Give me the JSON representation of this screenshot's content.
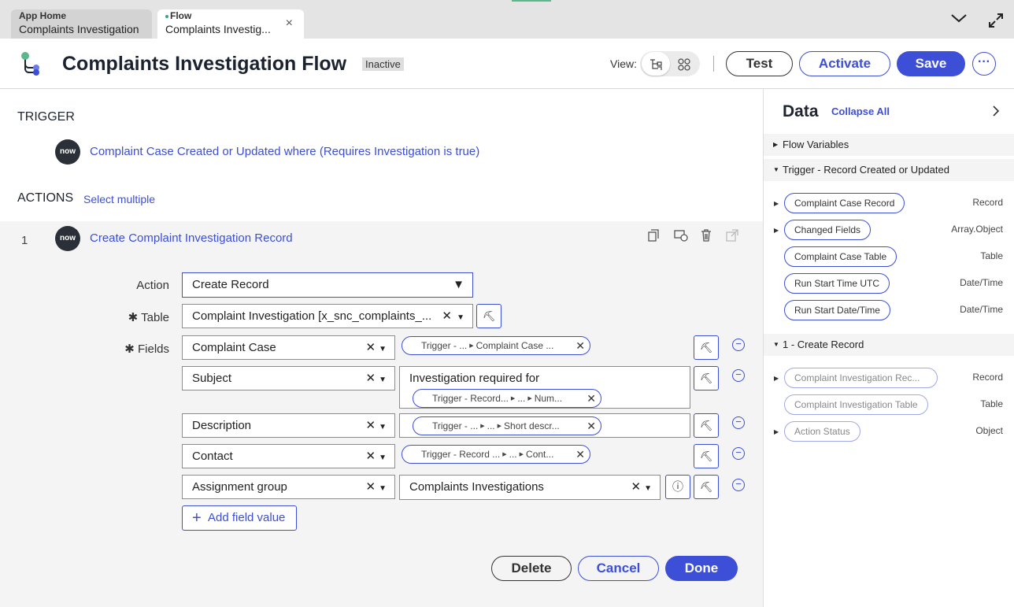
{
  "tabs": [
    {
      "title": "App Home",
      "subtitle": "Complaints Investigation"
    },
    {
      "title": "Flow",
      "subtitle": "Complaints Investig...",
      "close": "×"
    }
  ],
  "header": {
    "title": "Complaints Investigation Flow",
    "status": "Inactive",
    "view_label": "View:",
    "buttons": {
      "test": "Test",
      "activate": "Activate",
      "save": "Save",
      "more": "···"
    }
  },
  "trigger": {
    "section_label": "TRIGGER",
    "badge": "now",
    "description": "Complaint Case Created or Updated where (Requires Investigation is true)"
  },
  "actions": {
    "section_label": "ACTIONS",
    "select_multiple": "Select multiple",
    "step_number": "1",
    "badge": "now",
    "step_title": "Create Complaint Investigation Record"
  },
  "form": {
    "action_label": "Action",
    "action_value": "Create Record",
    "table_label": "Table",
    "table_value": "Complaint Investigation [x_snc_complaints_...",
    "fields_label": "Fields",
    "rows": [
      {
        "field": "Complaint Case",
        "pill_a": "Trigger - ...",
        "pill_b": "Complaint Case ..."
      },
      {
        "field": "Subject",
        "text": "Investigation required for",
        "pill_a": "Trigger - Record...",
        "pill_b": "...",
        "pill_c": "Num..."
      },
      {
        "field": "Description",
        "pill_a": "Trigger - ...",
        "pill_b": "...",
        "pill_c": "Short descr..."
      },
      {
        "field": "Contact",
        "pill_a": "Trigger - Record ...",
        "pill_b": "...",
        "pill_c": "Cont..."
      },
      {
        "field": "Assignment group",
        "value": "Complaints Investigations"
      }
    ],
    "add_field": "Add field value",
    "buttons": {
      "delete": "Delete",
      "cancel": "Cancel",
      "done": "Done"
    }
  },
  "data_panel": {
    "title": "Data",
    "collapse_all": "Collapse All",
    "groups": [
      {
        "label": "Flow Variables"
      },
      {
        "label": "Trigger - Record Created or Updated",
        "items": [
          {
            "label": "Complaint Case Record",
            "type": "Record"
          },
          {
            "label": "Changed Fields",
            "type": "Array.Object"
          },
          {
            "label": "Complaint Case Table",
            "type": "Table"
          },
          {
            "label": "Run Start Time UTC",
            "type": "Date/Time"
          },
          {
            "label": "Run Start Date/Time",
            "type": "Date/Time"
          }
        ]
      },
      {
        "label": "1 - Create Record",
        "items": [
          {
            "label": "Complaint Investigation Rec...",
            "type": "Record"
          },
          {
            "label": "Complaint Investigation Table",
            "type": "Table"
          },
          {
            "label": "Action Status",
            "type": "Object"
          }
        ]
      }
    ]
  },
  "colors": {
    "accent": "#3c4fd6",
    "badge": "#2b3038"
  }
}
